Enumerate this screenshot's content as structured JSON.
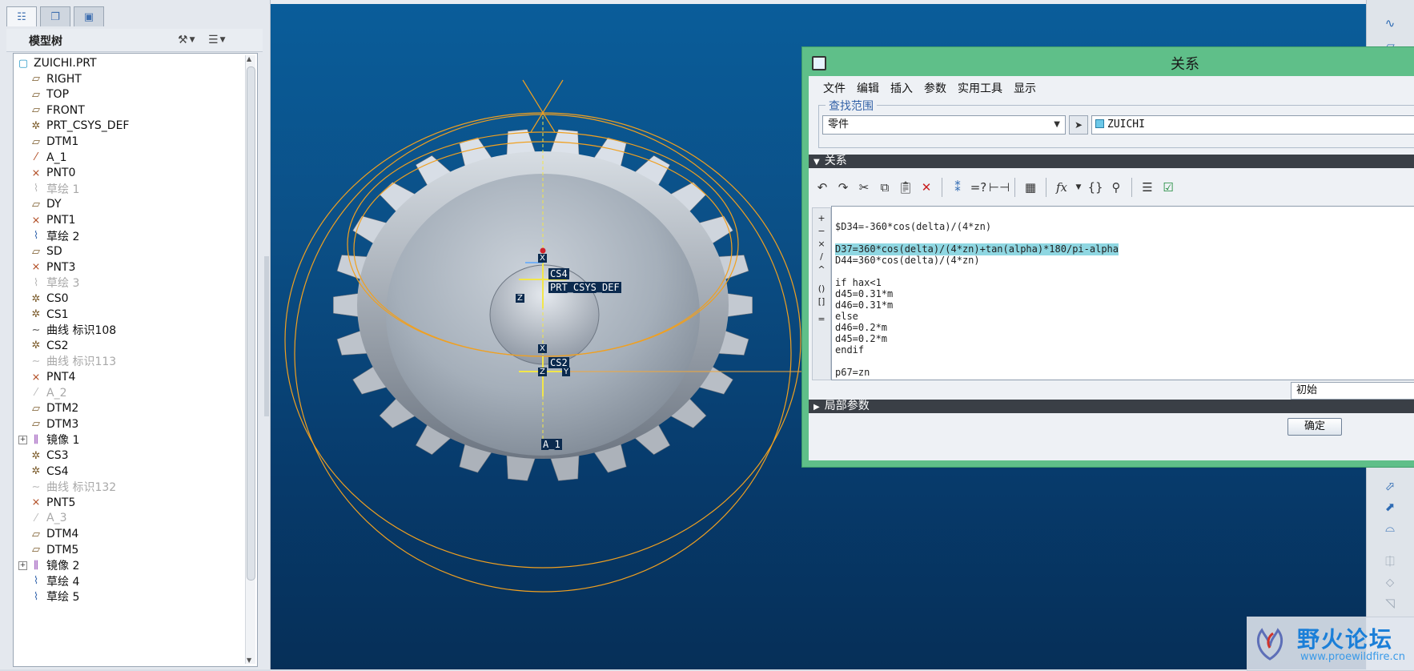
{
  "left_panel": {
    "tabs": [
      "model-tree-tab",
      "layers-tab",
      "favorites-tab"
    ],
    "title": "模型树",
    "tree_items": [
      {
        "label": "ZUICHI.PRT",
        "icon": "part-icon",
        "dim": false
      },
      {
        "label": "RIGHT",
        "icon": "datum-plane-icon",
        "dim": false
      },
      {
        "label": "TOP",
        "icon": "datum-plane-icon",
        "dim": false
      },
      {
        "label": "FRONT",
        "icon": "datum-plane-icon",
        "dim": false
      },
      {
        "label": "PRT_CSYS_DEF",
        "icon": "csys-icon",
        "dim": false
      },
      {
        "label": "DTM1",
        "icon": "datum-plane-icon",
        "dim": false
      },
      {
        "label": "A_1",
        "icon": "axis-icon",
        "dim": false
      },
      {
        "label": "PNT0",
        "icon": "datum-point-icon",
        "dim": false
      },
      {
        "label": "草绘 1",
        "icon": "sketch-icon",
        "dim": true
      },
      {
        "label": "DY",
        "icon": "datum-plane-icon",
        "dim": false
      },
      {
        "label": "PNT1",
        "icon": "datum-point-icon",
        "dim": false
      },
      {
        "label": "草绘 2",
        "icon": "sketch-icon",
        "dim": false
      },
      {
        "label": "SD",
        "icon": "datum-plane-icon",
        "dim": false
      },
      {
        "label": "PNT3",
        "icon": "datum-point-icon",
        "dim": false
      },
      {
        "label": "草绘 3",
        "icon": "sketch-icon",
        "dim": true
      },
      {
        "label": "CS0",
        "icon": "csys-icon",
        "dim": false
      },
      {
        "label": "CS1",
        "icon": "csys-icon",
        "dim": false
      },
      {
        "label": "曲线 标识108",
        "icon": "curve-icon",
        "dim": false
      },
      {
        "label": "CS2",
        "icon": "csys-icon",
        "dim": false
      },
      {
        "label": "曲线 标识113",
        "icon": "curve-icon",
        "dim": true
      },
      {
        "label": "PNT4",
        "icon": "datum-point-icon",
        "dim": false
      },
      {
        "label": "A_2",
        "icon": "axis-icon",
        "dim": true
      },
      {
        "label": "DTM2",
        "icon": "datum-plane-icon",
        "dim": false
      },
      {
        "label": "DTM3",
        "icon": "datum-plane-icon",
        "dim": false
      },
      {
        "label": "镜像 1",
        "icon": "mirror-icon",
        "dim": false,
        "expandable": true
      },
      {
        "label": "CS3",
        "icon": "csys-icon",
        "dim": false
      },
      {
        "label": "CS4",
        "icon": "csys-icon",
        "dim": false
      },
      {
        "label": "曲线 标识132",
        "icon": "curve-icon",
        "dim": true
      },
      {
        "label": "PNT5",
        "icon": "datum-point-icon",
        "dim": false
      },
      {
        "label": "A_3",
        "icon": "axis-icon",
        "dim": true
      },
      {
        "label": "DTM4",
        "icon": "datum-plane-icon",
        "dim": false
      },
      {
        "label": "DTM5",
        "icon": "datum-plane-icon",
        "dim": false
      },
      {
        "label": "镜像 2",
        "icon": "mirror-icon",
        "dim": false,
        "expandable": true
      },
      {
        "label": "草绘 4",
        "icon": "sketch-icon",
        "dim": false
      },
      {
        "label": "草绘 5",
        "icon": "sketch-icon",
        "dim": false
      }
    ]
  },
  "viewport": {
    "labels": {
      "cs4": "CS4",
      "prt_csys": "PRT_CSYS_DEF",
      "cs2": "CS2",
      "axis": "A_1",
      "x1": "X",
      "z1": "Z",
      "x2": "X",
      "z2": "Z",
      "y2": "Y"
    }
  },
  "dialog": {
    "title": "关系",
    "menu": [
      "文件",
      "编辑",
      "插入",
      "参数",
      "实用工具",
      "显示"
    ],
    "scope": {
      "legend": "查找范围",
      "type_value": "零件",
      "name_value": "ZUICHI"
    },
    "relations_section": "关系",
    "ops": [
      "+",
      "−",
      "×",
      "/",
      "^",
      "()",
      "[]",
      "="
    ],
    "code_lines": [
      "$D34=-360*cos(delta)/(4*zn)",
      "",
      "D37=360*cos(delta)/(4*zn)+tan(alpha)*180/pi-alpha",
      "D44=360*cos(delta)/(4*zn)",
      "",
      "if hax<1",
      "d45=0.31*m",
      "d46=0.31*m",
      "else",
      "d46=0.2*m",
      "d45=0.2*m",
      "endif",
      "",
      "p67=zn"
    ],
    "initial_value": "初始",
    "local_params_section": "局部参数",
    "ok_label": "确定"
  },
  "watermark": {
    "text": "野火论坛",
    "url": "www.proewildfire.cn"
  },
  "colors": {
    "viewport_top": "#0a5d9a",
    "viewport_bottom": "#062f58",
    "dialog_frame": "#5fbf89",
    "highlight": "#8fd7e2",
    "datum_curve": "#f0a020",
    "axis_line": "#f2e64a"
  }
}
